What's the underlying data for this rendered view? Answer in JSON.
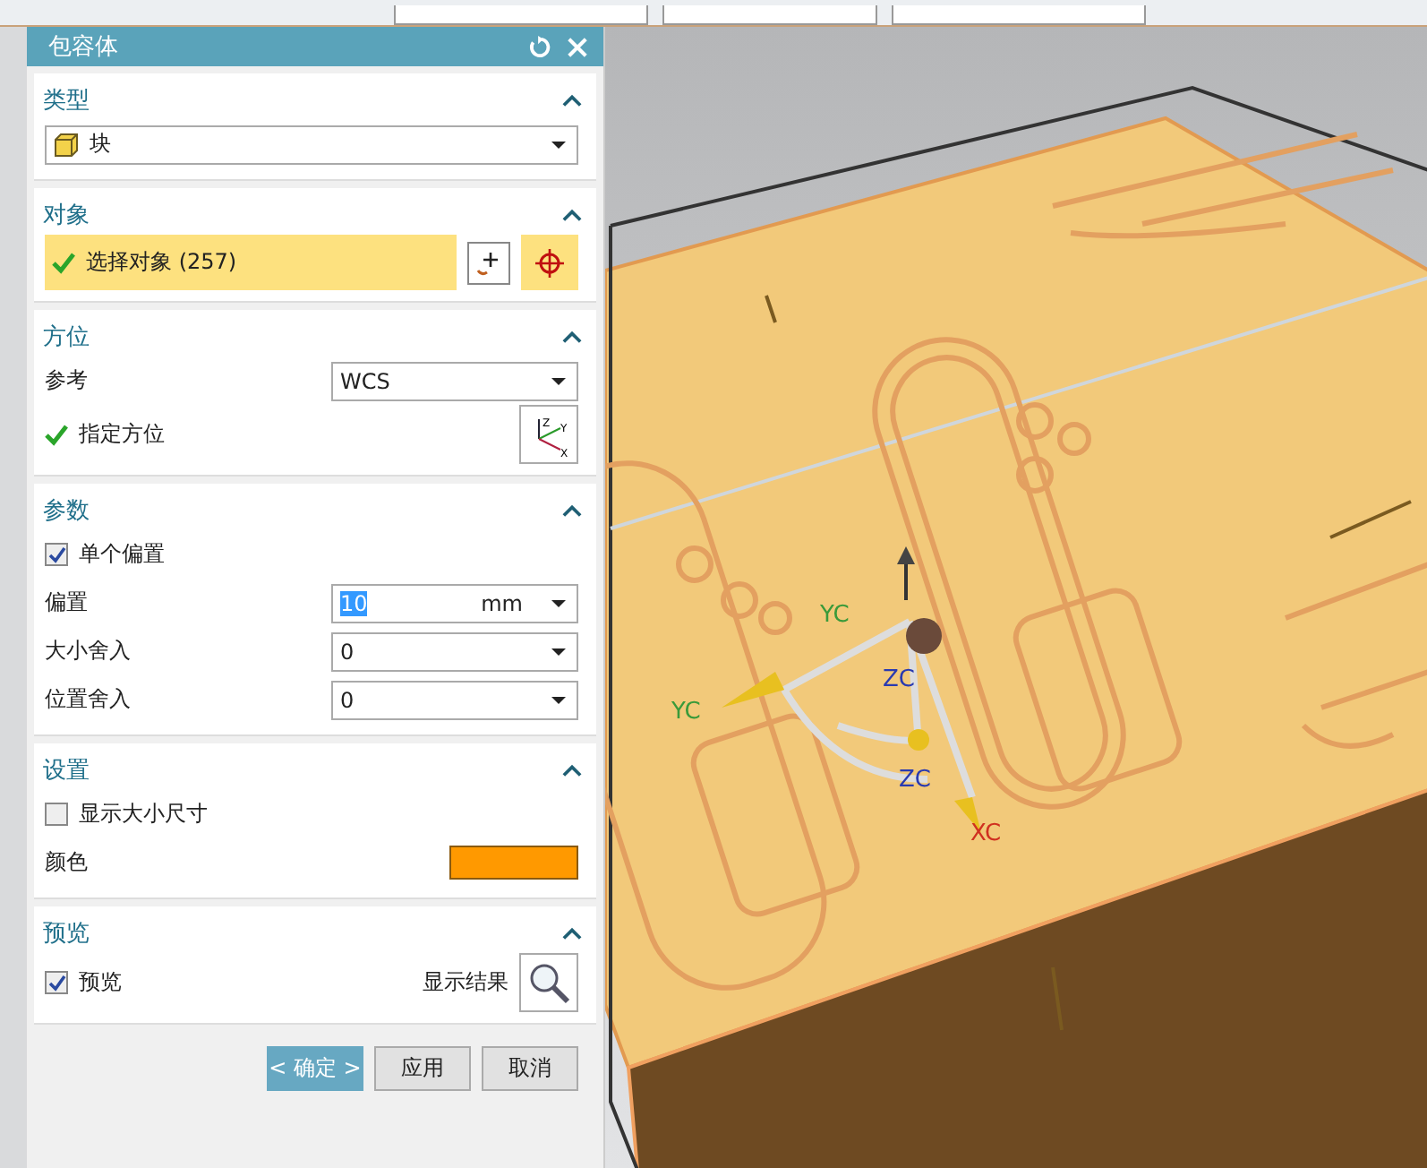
{
  "dialog": {
    "title": "包容体"
  },
  "sections": [
    {
      "title": "类型",
      "expanded": true,
      "rows": [
        {
          "kind": "shape-combo",
          "value": "块"
        }
      ]
    },
    {
      "title": "对象",
      "expanded": true,
      "rows": [
        {
          "kind": "selection",
          "label": "选择对象 (257)",
          "done": true
        }
      ]
    },
    {
      "title": "方位",
      "expanded": true,
      "rows": [
        {
          "kind": "combo",
          "label": "参考",
          "value": "WCS"
        },
        {
          "kind": "csys",
          "label": "指定方位",
          "done": true,
          "axes": [
            "Z",
            "Y",
            "X"
          ]
        }
      ]
    },
    {
      "title": "参数",
      "expanded": true,
      "rows": [
        {
          "kind": "checkbox",
          "label": "单个偏置",
          "checked": true
        },
        {
          "kind": "unit",
          "label": "偏置",
          "value": "10",
          "unit": "mm"
        },
        {
          "kind": "combo",
          "label": "大小舍入",
          "value": "0"
        },
        {
          "kind": "combo",
          "label": "位置舍入",
          "value": "0"
        }
      ]
    },
    {
      "title": "设置",
      "expanded": true,
      "rows": [
        {
          "kind": "checkbox",
          "label": "显示大小尺寸",
          "checked": false
        },
        {
          "kind": "color",
          "label": "颜色",
          "color": "#ff9900"
        }
      ]
    },
    {
      "title": "预览",
      "expanded": true,
      "rows": [
        {
          "kind": "preview",
          "label": "预览",
          "checked": true,
          "button": "显示结果"
        }
      ]
    }
  ],
  "buttons": [
    {
      "label": "< 确定 >",
      "kind": "primary"
    },
    {
      "label": "应用",
      "kind": "normal"
    },
    {
      "label": "取消",
      "kind": "normal"
    }
  ],
  "viewport": {
    "axis_labels": [
      {
        "text": "YC",
        "color": "#3a9a3a"
      },
      {
        "text": "YC",
        "color": "#3a9a3a"
      },
      {
        "text": "ZC",
        "color": "#2a3ab0"
      },
      {
        "text": "ZC",
        "color": "#2a3ab0"
      },
      {
        "text": "XC",
        "color": "#d03020"
      }
    ]
  }
}
